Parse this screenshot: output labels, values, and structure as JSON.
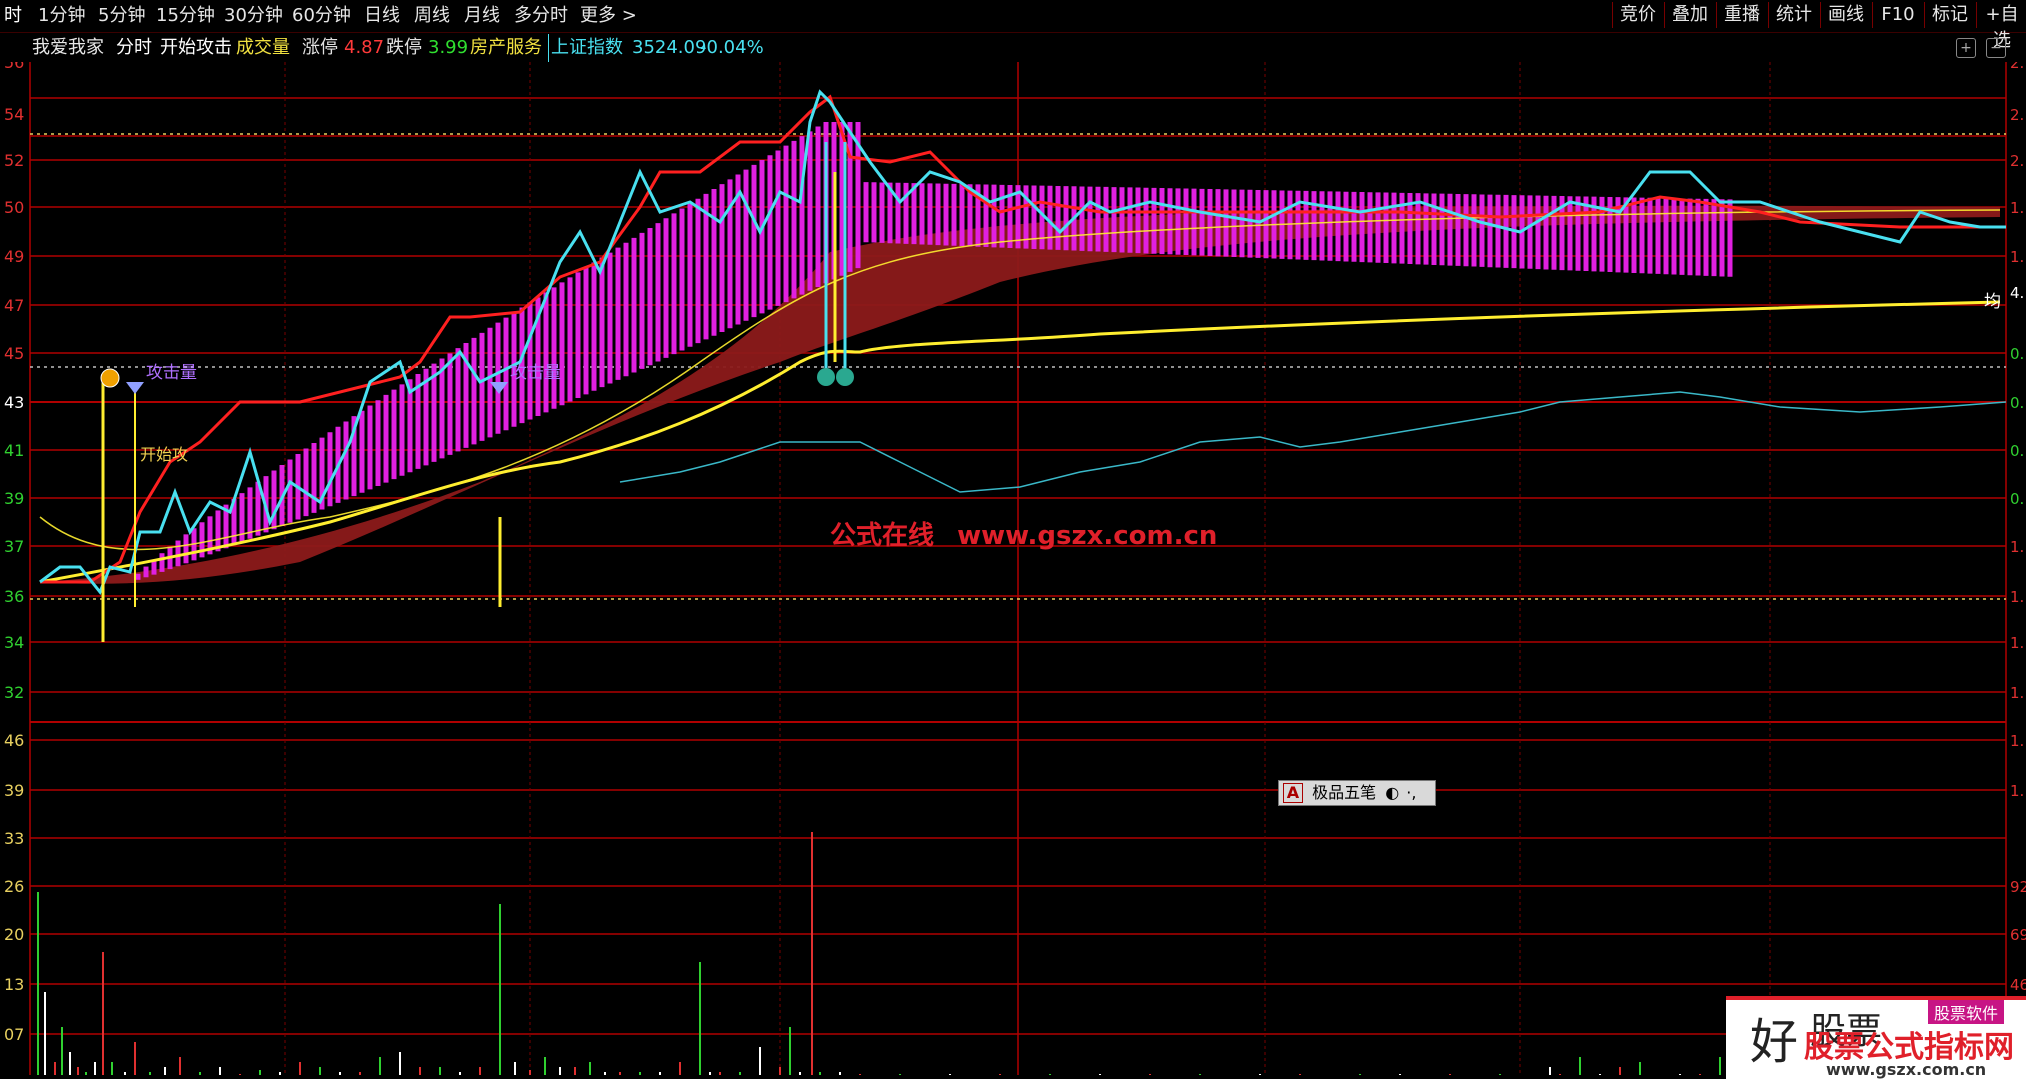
{
  "toolbar": {
    "periods": [
      {
        "label": "时",
        "active": true
      },
      {
        "label": "1分钟"
      },
      {
        "label": "5分钟"
      },
      {
        "label": "15分钟"
      },
      {
        "label": "30分钟"
      },
      {
        "label": "60分钟"
      },
      {
        "label": "日线"
      },
      {
        "label": "周线"
      },
      {
        "label": "月线"
      },
      {
        "label": "多分时"
      },
      {
        "label": "更多 >"
      }
    ],
    "right_buttons": [
      "竞价",
      "叠加",
      "重播",
      "统计",
      "画线",
      "F10",
      "标记",
      "+自选"
    ]
  },
  "info": {
    "stock_name": "我爱我家",
    "view": "分时",
    "indicator": "开始攻击",
    "volume_label": "成交量",
    "limit_up_label": "涨停",
    "limit_up_value": "4.87",
    "limit_down_label": "跌停",
    "limit_down_value": "3.99",
    "sector": "房产服务",
    "index_name": "上证指数",
    "index_value": "3524.09",
    "index_change": "-0.04%"
  },
  "chart_labels": {
    "left_price_ticks": [
      "56",
      "54",
      "52",
      "50",
      "49",
      "47",
      "45",
      "43",
      "41",
      "39",
      "37",
      "36",
      "34",
      "32"
    ],
    "left_volume_ticks": [
      "46",
      "39",
      "33",
      "26",
      "20",
      "13",
      "07"
    ],
    "right_ticks": [
      "2.",
      "2.",
      "2.",
      "1.",
      "1.",
      "4.",
      "0.",
      "0.",
      "0.",
      "0.",
      "1.",
      "1.",
      "1.",
      "1.",
      "1.",
      "1.",
      "92",
      "69",
      "46"
    ],
    "avg_label": "均",
    "signal_attack_label": "攻击量",
    "signal_start_label": "开始攻",
    "signal_attack_label2": "攻击量"
  },
  "watermark": {
    "cn": "公式在线",
    "url": "www.gszx.com.cn"
  },
  "ime_bar": {
    "logo": "A",
    "name": "极品五笔"
  },
  "brand_badge": {
    "char": "好",
    "partial": "股票",
    "title": "股票公式指标网",
    "url": "www.gszx.com.cn",
    "tag": "股票软件"
  },
  "colors": {
    "price_line": "#49e0f0",
    "limit_line": "#ff2020",
    "avg_line": "#ffee30",
    "bars": "#e020e0",
    "band": "#8c1a1a",
    "grid": "#b00000",
    "bg": "#000000"
  }
}
